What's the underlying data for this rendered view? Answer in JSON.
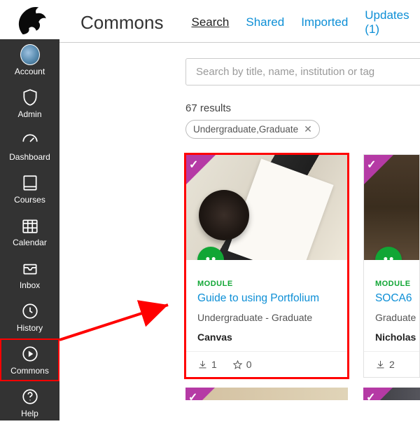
{
  "sidebar": {
    "items": [
      {
        "label": "Account"
      },
      {
        "label": "Admin"
      },
      {
        "label": "Dashboard"
      },
      {
        "label": "Courses"
      },
      {
        "label": "Calendar"
      },
      {
        "label": "Inbox"
      },
      {
        "label": "History"
      },
      {
        "label": "Commons"
      },
      {
        "label": "Help"
      }
    ]
  },
  "header": {
    "title": "Commons",
    "tabs": [
      {
        "label": "Search",
        "active": true
      },
      {
        "label": "Shared"
      },
      {
        "label": "Imported"
      },
      {
        "label": "Updates (1)"
      }
    ]
  },
  "search": {
    "placeholder": "Search by title, name, institution or tag",
    "results_count": "67 results",
    "filter_chip": "Undergraduate,Graduate",
    "chip_close": "✕"
  },
  "cards": [
    {
      "kicker": "MODULE",
      "title": "Guide to using Portfolium",
      "subtitle": "Undergraduate - Graduate",
      "author": "Canvas",
      "downloads": "1",
      "stars": "0"
    },
    {
      "kicker": "MODULE",
      "title": "SOCA6",
      "subtitle": "Graduate",
      "author": "Nicholas",
      "downloads": "2",
      "stars": ""
    }
  ]
}
